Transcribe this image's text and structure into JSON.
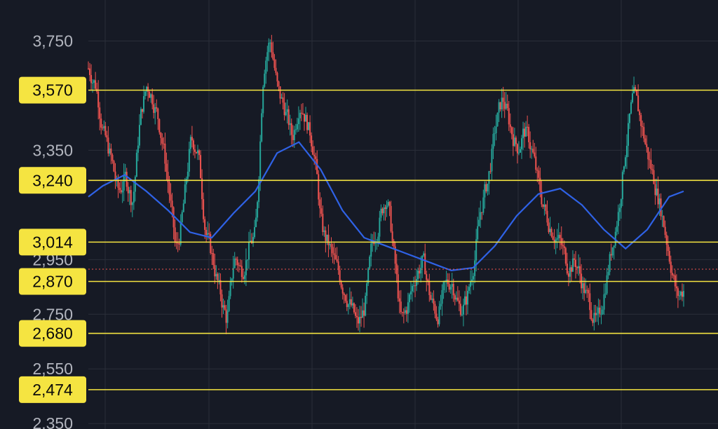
{
  "chart_data": {
    "type": "candlestick",
    "y_axis": {
      "ticks": [
        "3,750",
        "3,350",
        "2,950",
        "2,750",
        "2,550",
        "2,350"
      ],
      "tick_values": [
        3750,
        3350,
        2950,
        2750,
        2550,
        2350
      ],
      "range": [
        2330,
        3900
      ]
    },
    "horizontal_levels": [
      {
        "label": "3,570",
        "value": 3570
      },
      {
        "label": "3,240",
        "value": 3240
      },
      {
        "label": "3,014",
        "value": 3014
      },
      {
        "label": "2,870",
        "value": 2870
      },
      {
        "label": "2,680",
        "value": 2680
      },
      {
        "label": "2,474",
        "value": 2474
      }
    ],
    "current_price_value": 2915,
    "price_path": [
      [
        0,
        3650
      ],
      [
        2,
        3580
      ],
      [
        4,
        3400
      ],
      [
        6,
        3320
      ],
      [
        8,
        3180
      ],
      [
        10,
        3260
      ],
      [
        12,
        3150
      ],
      [
        14,
        3480
      ],
      [
        16,
        3600
      ],
      [
        18,
        3520
      ],
      [
        20,
        3400
      ],
      [
        22,
        3200
      ],
      [
        24,
        2950
      ],
      [
        26,
        3150
      ],
      [
        28,
        3400
      ],
      [
        30,
        3350
      ],
      [
        32,
        3050
      ],
      [
        34,
        2950
      ],
      [
        36,
        2820
      ],
      [
        38,
        2720
      ],
      [
        40,
        2980
      ],
      [
        42,
        2900
      ],
      [
        44,
        3000
      ],
      [
        46,
        3050
      ],
      [
        48,
        3700
      ],
      [
        50,
        3760
      ],
      [
        52,
        3550
      ],
      [
        54,
        3500
      ],
      [
        56,
        3380
      ],
      [
        58,
        3550
      ],
      [
        60,
        3450
      ],
      [
        62,
        3350
      ],
      [
        64,
        3050
      ],
      [
        66,
        3000
      ],
      [
        68,
        2920
      ],
      [
        70,
        2850
      ],
      [
        72,
        2780
      ],
      [
        74,
        2700
      ],
      [
        76,
        2780
      ],
      [
        78,
        3020
      ],
      [
        80,
        3100
      ],
      [
        82,
        3200
      ],
      [
        84,
        2950
      ],
      [
        86,
        2700
      ],
      [
        88,
        2800
      ],
      [
        90,
        2900
      ],
      [
        92,
        2950
      ],
      [
        94,
        2800
      ],
      [
        96,
        2740
      ],
      [
        98,
        2850
      ],
      [
        100,
        2880
      ],
      [
        102,
        2760
      ],
      [
        104,
        2800
      ],
      [
        106,
        2950
      ],
      [
        108,
        3150
      ],
      [
        110,
        3250
      ],
      [
        112,
        3450
      ],
      [
        114,
        3550
      ],
      [
        116,
        3430
      ],
      [
        118,
        3350
      ],
      [
        120,
        3430
      ],
      [
        122,
        3350
      ],
      [
        124,
        3200
      ],
      [
        126,
        3100
      ],
      [
        128,
        3050
      ],
      [
        130,
        3000
      ],
      [
        132,
        2920
      ],
      [
        134,
        2950
      ],
      [
        136,
        2850
      ],
      [
        138,
        2780
      ],
      [
        140,
        2700
      ],
      [
        142,
        2850
      ],
      [
        144,
        3000
      ],
      [
        146,
        3150
      ],
      [
        148,
        3400
      ],
      [
        150,
        3560
      ],
      [
        152,
        3450
      ],
      [
        154,
        3320
      ],
      [
        156,
        3220
      ],
      [
        158,
        3100
      ],
      [
        160,
        2950
      ],
      [
        162,
        2800
      ],
      [
        164,
        2850
      ]
    ],
    "moving_average": [
      [
        0,
        3180
      ],
      [
        4,
        3220
      ],
      [
        10,
        3260
      ],
      [
        16,
        3200
      ],
      [
        22,
        3130
      ],
      [
        28,
        3050
      ],
      [
        34,
        3030
      ],
      [
        40,
        3120
      ],
      [
        46,
        3200
      ],
      [
        52,
        3340
      ],
      [
        58,
        3380
      ],
      [
        64,
        3280
      ],
      [
        70,
        3130
      ],
      [
        76,
        3030
      ],
      [
        82,
        3000
      ],
      [
        88,
        2970
      ],
      [
        94,
        2940
      ],
      [
        100,
        2910
      ],
      [
        106,
        2920
      ],
      [
        112,
        3000
      ],
      [
        118,
        3110
      ],
      [
        124,
        3190
      ],
      [
        130,
        3210
      ],
      [
        136,
        3150
      ],
      [
        142,
        3060
      ],
      [
        148,
        2990
      ],
      [
        154,
        3060
      ],
      [
        160,
        3180
      ],
      [
        164,
        3200
      ]
    ],
    "colors": {
      "background": "#161a25",
      "grid": "#2a2e39",
      "level_line": "#f5e441",
      "level_tag": "#f5e441",
      "moving_average": "#2f62e6",
      "candle_up": "#26a69a",
      "candle_down": "#ef5350",
      "current_price_line": "#ef5350"
    }
  }
}
